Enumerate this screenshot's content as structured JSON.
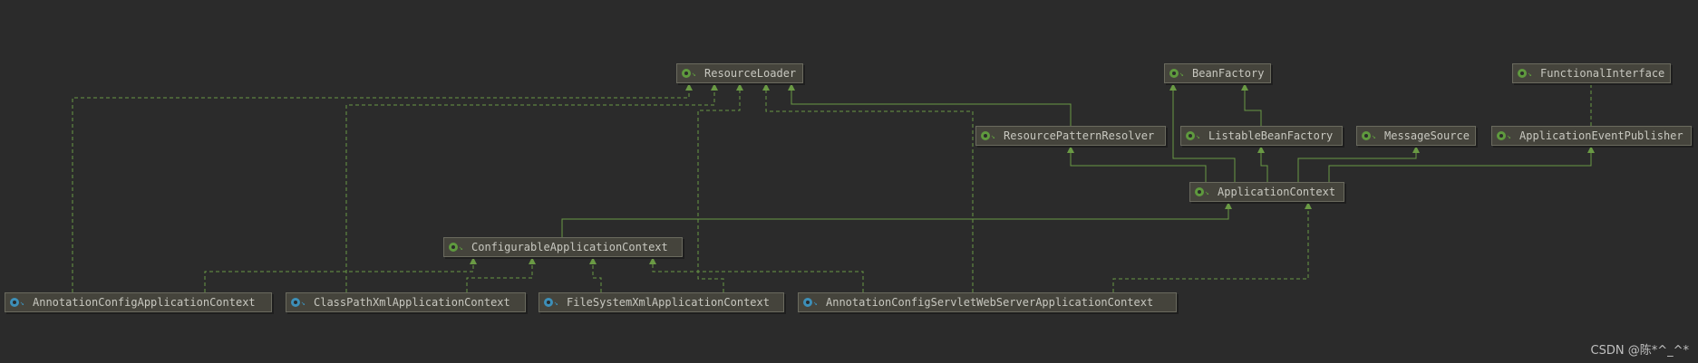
{
  "colors": {
    "background": "#2b2b2b",
    "extends_line": "#6a9a44",
    "implements_line": "#6a9a44",
    "interface_icon": "#5f9a3e",
    "class_icon": "#3d8fb8"
  },
  "nodes": [
    {
      "id": "ResourceLoader",
      "label": "ResourceLoader",
      "kind": "interface"
    },
    {
      "id": "BeanFactory",
      "label": "BeanFactory",
      "kind": "interface"
    },
    {
      "id": "FunctionalInterface",
      "label": "FunctionalInterface",
      "kind": "annotation"
    },
    {
      "id": "ResourcePatternResolver",
      "label": "ResourcePatternResolver",
      "kind": "interface"
    },
    {
      "id": "ListableBeanFactory",
      "label": "ListableBeanFactory",
      "kind": "interface"
    },
    {
      "id": "MessageSource",
      "label": "MessageSource",
      "kind": "interface"
    },
    {
      "id": "ApplicationEventPublisher",
      "label": "ApplicationEventPublisher",
      "kind": "interface"
    },
    {
      "id": "ApplicationContext",
      "label": "ApplicationContext",
      "kind": "interface"
    },
    {
      "id": "ConfigurableApplicationContext",
      "label": "ConfigurableApplicationContext",
      "kind": "interface"
    },
    {
      "id": "AnnotationConfigApplicationContext",
      "label": "AnnotationConfigApplicationContext",
      "kind": "class"
    },
    {
      "id": "ClassPathXmlApplicationContext",
      "label": "ClassPathXmlApplicationContext",
      "kind": "class"
    },
    {
      "id": "FileSystemXmlApplicationContext",
      "label": "FileSystemXmlApplicationContext",
      "kind": "class"
    },
    {
      "id": "AnnotationConfigServletWebServerApplicationContext",
      "label": "AnnotationConfigServletWebServerApplicationContext",
      "kind": "class"
    }
  ],
  "edges": [
    {
      "from": "ResourcePatternResolver",
      "to": "ResourceLoader",
      "style": "solid"
    },
    {
      "from": "ListableBeanFactory",
      "to": "BeanFactory",
      "style": "solid"
    },
    {
      "from": "ApplicationContext",
      "to": "BeanFactory",
      "style": "solid"
    },
    {
      "from": "ApplicationContext",
      "to": "ResourcePatternResolver",
      "style": "solid"
    },
    {
      "from": "ApplicationContext",
      "to": "ListableBeanFactory",
      "style": "solid"
    },
    {
      "from": "ApplicationContext",
      "to": "MessageSource",
      "style": "solid"
    },
    {
      "from": "ApplicationContext",
      "to": "ApplicationEventPublisher",
      "style": "solid"
    },
    {
      "from": "ApplicationEventPublisher",
      "to": "FunctionalInterface",
      "style": "dashed"
    },
    {
      "from": "ConfigurableApplicationContext",
      "to": "ApplicationContext",
      "style": "solid"
    },
    {
      "from": "AnnotationConfigApplicationContext",
      "to": "ConfigurableApplicationContext",
      "style": "dashed"
    },
    {
      "from": "AnnotationConfigApplicationContext",
      "to": "ResourceLoader",
      "style": "dashed"
    },
    {
      "from": "ClassPathXmlApplicationContext",
      "to": "ConfigurableApplicationContext",
      "style": "dashed"
    },
    {
      "from": "ClassPathXmlApplicationContext",
      "to": "ResourceLoader",
      "style": "dashed"
    },
    {
      "from": "FileSystemXmlApplicationContext",
      "to": "ConfigurableApplicationContext",
      "style": "dashed"
    },
    {
      "from": "FileSystemXmlApplicationContext",
      "to": "ResourceLoader",
      "style": "dashed"
    },
    {
      "from": "AnnotationConfigServletWebServerApplicationContext",
      "to": "ConfigurableApplicationContext",
      "style": "dashed"
    },
    {
      "from": "AnnotationConfigServletWebServerApplicationContext",
      "to": "ResourceLoader",
      "style": "dashed"
    },
    {
      "from": "AnnotationConfigServletWebServerApplicationContext",
      "to": "ApplicationContext",
      "style": "dashed"
    }
  ],
  "watermark": "CSDN @陈*^_^*"
}
